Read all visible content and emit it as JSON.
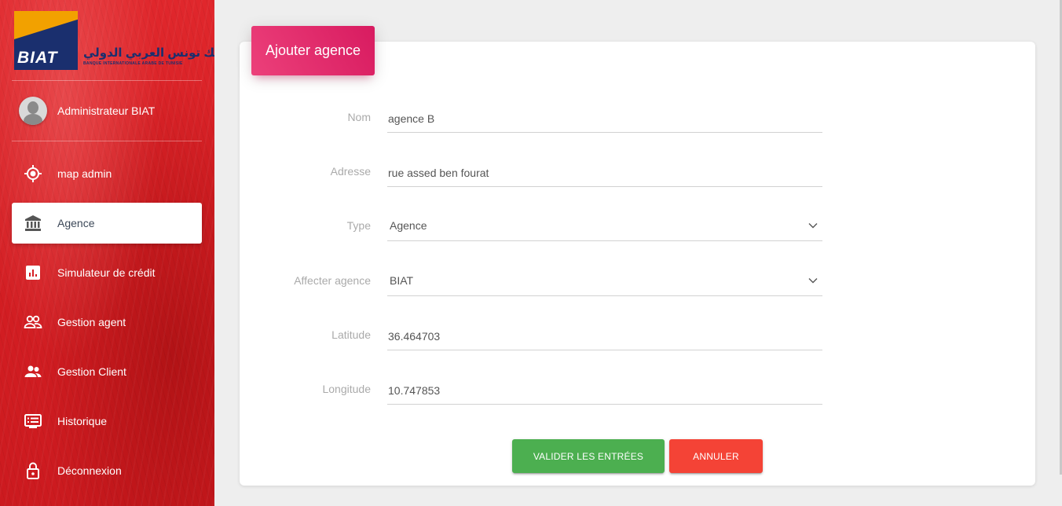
{
  "brand": {
    "logo_text": "BIAT",
    "logo_arabic": "بنك تونس العربي الدولي",
    "logo_subtitle": "BANQUE INTERNATIONALE ARABE DE TUNISIE",
    "colors": {
      "sidebar": "#d61f24",
      "logo_blue": "#1a2f6e",
      "logo_orange": "#f2a100"
    }
  },
  "user": {
    "name": "Administrateur BIAT"
  },
  "sidebar": {
    "items": [
      {
        "label": "map admin",
        "icon": "location-target-icon"
      },
      {
        "label": "Agence",
        "icon": "bank-icon",
        "active": true
      },
      {
        "label": "Simulateur de crédit",
        "icon": "bar-chart-icon"
      },
      {
        "label": "Gestion agent",
        "icon": "people-outline-icon"
      },
      {
        "label": "Gestion Client",
        "icon": "people-icon"
      },
      {
        "label": "Historique",
        "icon": "history-list-icon"
      },
      {
        "label": "Déconnexion",
        "icon": "lock-open-icon"
      }
    ]
  },
  "form": {
    "title": "Ajouter agence",
    "title_color": "#e91e63",
    "fields": {
      "nom": {
        "label": "Nom",
        "value": "agence B"
      },
      "adresse": {
        "label": "Adresse",
        "value": "rue assed ben fourat"
      },
      "type": {
        "label": "Type",
        "value": "Agence"
      },
      "affecter": {
        "label": "Affecter agence",
        "value": "BIAT"
      },
      "latitude": {
        "label": "Latitude",
        "value": "36.464703"
      },
      "longitude": {
        "label": "Longitude",
        "value": "10.747853"
      }
    },
    "buttons": {
      "submit": "VALIDER LES ENTRÉES",
      "cancel": "ANNULER",
      "submit_color": "#4caf50",
      "cancel_color": "#f44336"
    }
  }
}
